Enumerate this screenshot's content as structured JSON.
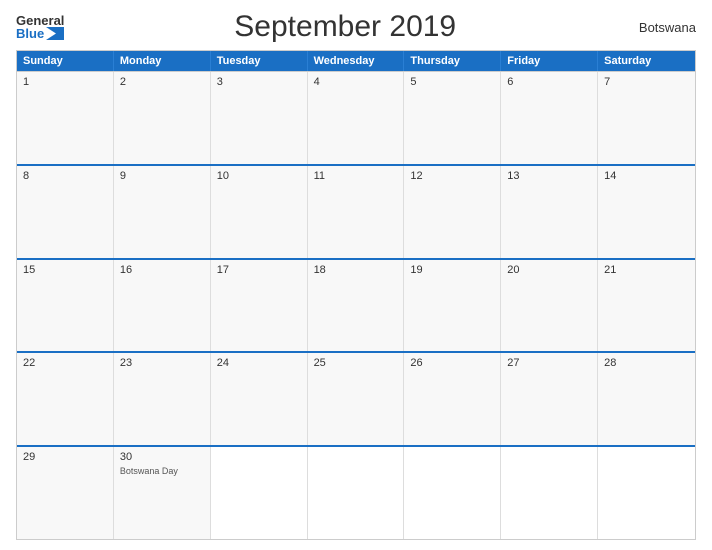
{
  "header": {
    "logo_general": "General",
    "logo_blue": "Blue",
    "title": "September 2019",
    "country": "Botswana"
  },
  "day_headers": [
    "Sunday",
    "Monday",
    "Tuesday",
    "Wednesday",
    "Thursday",
    "Friday",
    "Saturday"
  ],
  "weeks": [
    [
      {
        "num": "1",
        "holiday": ""
      },
      {
        "num": "2",
        "holiday": ""
      },
      {
        "num": "3",
        "holiday": ""
      },
      {
        "num": "4",
        "holiday": ""
      },
      {
        "num": "5",
        "holiday": ""
      },
      {
        "num": "6",
        "holiday": ""
      },
      {
        "num": "7",
        "holiday": ""
      }
    ],
    [
      {
        "num": "8",
        "holiday": ""
      },
      {
        "num": "9",
        "holiday": ""
      },
      {
        "num": "10",
        "holiday": ""
      },
      {
        "num": "11",
        "holiday": ""
      },
      {
        "num": "12",
        "holiday": ""
      },
      {
        "num": "13",
        "holiday": ""
      },
      {
        "num": "14",
        "holiday": ""
      }
    ],
    [
      {
        "num": "15",
        "holiday": ""
      },
      {
        "num": "16",
        "holiday": ""
      },
      {
        "num": "17",
        "holiday": ""
      },
      {
        "num": "18",
        "holiday": ""
      },
      {
        "num": "19",
        "holiday": ""
      },
      {
        "num": "20",
        "holiday": ""
      },
      {
        "num": "21",
        "holiday": ""
      }
    ],
    [
      {
        "num": "22",
        "holiday": ""
      },
      {
        "num": "23",
        "holiday": ""
      },
      {
        "num": "24",
        "holiday": ""
      },
      {
        "num": "25",
        "holiday": ""
      },
      {
        "num": "26",
        "holiday": ""
      },
      {
        "num": "27",
        "holiday": ""
      },
      {
        "num": "28",
        "holiday": ""
      }
    ],
    [
      {
        "num": "29",
        "holiday": ""
      },
      {
        "num": "30",
        "holiday": "Botswana Day"
      },
      {
        "num": "",
        "holiday": ""
      },
      {
        "num": "",
        "holiday": ""
      },
      {
        "num": "",
        "holiday": ""
      },
      {
        "num": "",
        "holiday": ""
      },
      {
        "num": "",
        "holiday": ""
      }
    ]
  ]
}
